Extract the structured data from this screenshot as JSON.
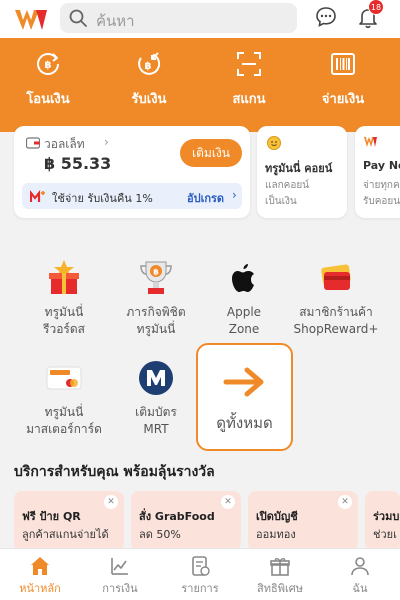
{
  "header": {
    "search_placeholder": "ค้นหา",
    "notification_count": "18"
  },
  "actions": [
    {
      "label": "โอนเงิน",
      "icon": "transfer-icon"
    },
    {
      "label": "รับเงิน",
      "icon": "receive-icon"
    },
    {
      "label": "สแกน",
      "icon": "scan-icon"
    },
    {
      "label": "จ่ายเงิน",
      "icon": "barcode-icon"
    }
  ],
  "wallet": {
    "label": "วอลเล็ท",
    "balance": "฿ 55.33",
    "topup_label": "เติมเงิน",
    "cashback_text": "ใช้จ่าย รับเงินคืน 1%",
    "upgrade_label": "อัปเกรด"
  },
  "coin_card": {
    "title": "ทรูมันนี่ คอยน์",
    "line1": "แลกคอยน์",
    "line2": "เป็นเงิน"
  },
  "pay_card": {
    "title": "Pay Ne",
    "line1": "จ่ายทุกค",
    "line2": "รับคอยน"
  },
  "services": [
    {
      "line1": "ทรูมันนี่",
      "line2": "รีวอร์ดส",
      "icon": "gift-icon"
    },
    {
      "line1": "ภารกิจพิชิต",
      "line2": "ทรูมันนี่",
      "icon": "trophy-icon"
    },
    {
      "line1": "Apple",
      "line2": "Zone",
      "icon": "apple-icon"
    },
    {
      "line1": "สมาชิกร้านค้า",
      "line2": "ShopReward+",
      "icon": "shopreward-icon"
    },
    {
      "line1": "ทรูมันนี่",
      "line2": "มาสเตอร์การ์ด",
      "icon": "mastercard-icon"
    },
    {
      "line1": "เติมบัตร",
      "line2": "MRT",
      "icon": "mrt-icon"
    }
  ],
  "see_all_label": "ดูทั้งหมด",
  "rewards_title": "บริการสำหรับคุณ พร้อมลุ้นรางวัล",
  "promos": [
    {
      "line1": "ฟรี ป้าย QR",
      "line2": "ลูกค้าสแกนจ่ายได้"
    },
    {
      "line1": "สั่ง GrabFood",
      "line2": "ลด 50%"
    },
    {
      "line1": "เปิดบัญชี",
      "line2": "ออมทอง"
    },
    {
      "line1": "ร่วมบ",
      "line2": "ช่วยเ"
    }
  ],
  "bottom_nav": [
    {
      "label": "หน้าหลัก",
      "active": true
    },
    {
      "label": "การเงิน"
    },
    {
      "label": "รายการ"
    },
    {
      "label": "สิทธิพิเศษ"
    },
    {
      "label": "ฉัน"
    }
  ],
  "colors": {
    "accent": "#f08a28",
    "link": "#2a5cc4",
    "badge": "#e52b2b"
  }
}
